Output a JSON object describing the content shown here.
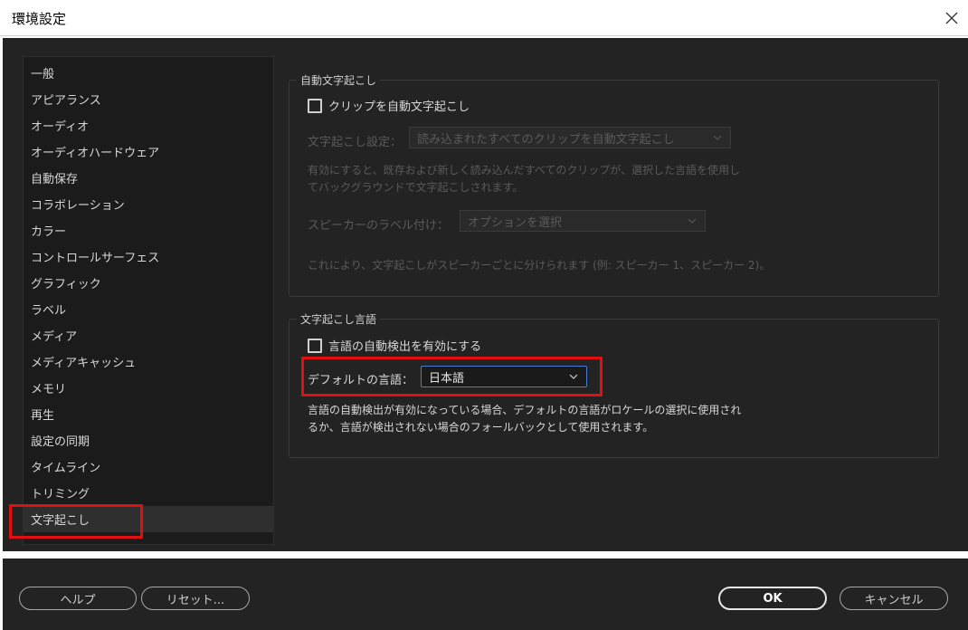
{
  "window": {
    "title": "環境設定"
  },
  "sidebar": {
    "items": [
      {
        "label": "一般"
      },
      {
        "label": "アピアランス"
      },
      {
        "label": "オーディオ"
      },
      {
        "label": "オーディオハードウェア"
      },
      {
        "label": "自動保存"
      },
      {
        "label": "コラボレーション"
      },
      {
        "label": "カラー"
      },
      {
        "label": "コントロールサーフェス"
      },
      {
        "label": "グラフィック"
      },
      {
        "label": "ラベル"
      },
      {
        "label": "メディア"
      },
      {
        "label": "メディアキャッシュ"
      },
      {
        "label": "メモリ"
      },
      {
        "label": "再生"
      },
      {
        "label": "設定の同期"
      },
      {
        "label": "タイムライン"
      },
      {
        "label": "トリミング"
      },
      {
        "label": "文字起こし"
      }
    ],
    "selected": "文字起こし"
  },
  "auto_transcription": {
    "legend": "自動文字起こし",
    "checkbox_label": "クリップを自動文字起こし",
    "checked": false,
    "setting_label": "文字起こし設定：",
    "setting_value": "読み込まれたすべてのクリップを自動文字起こし",
    "description_line1": "有効にすると、既存および新しく読み込んだすべてのクリップが、選択した言語を使用し",
    "description_line2": "てバックグラウンドで文字起こしされます。",
    "speaker_label": "スピーカーのラベル付け：",
    "speaker_placeholder": "オプションを選択",
    "speaker_note": "これにより、文字起こしがスピーカーごとに分けられます (例: スピーカー 1、スピーカー 2)。"
  },
  "transcription_language": {
    "legend": "文字起こし言語",
    "auto_detect_label": "言語の自動検出を有効にする",
    "auto_detect_checked": false,
    "default_language_label": "デフォルトの言語：",
    "default_language_value": "日本語",
    "description_line1": "言語の自動検出が有効になっている場合、デフォルトの言語がロケールの選択に使用され",
    "description_line2": "るか、言語が検出されない場合のフォールバックとして使用されます。"
  },
  "footer": {
    "help_label": "ヘルプ",
    "reset_label": "リセット...",
    "ok_label": "OK",
    "cancel_label": "キャンセル"
  },
  "colors": {
    "panel_bg": "#232323",
    "sidebar_bg": "#1b1b1b",
    "highlight": "#e01010",
    "focus": "#4a7bd0"
  }
}
